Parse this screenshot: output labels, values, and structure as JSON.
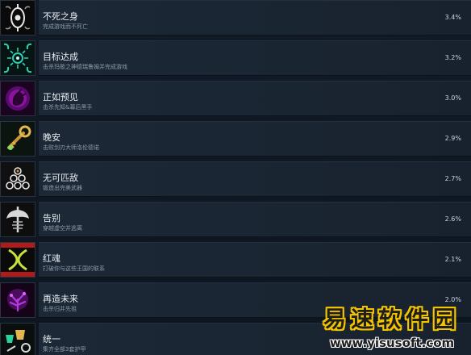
{
  "achievements": [
    {
      "title": "不死之身",
      "desc": "完成游戏而不死亡",
      "pct": "3.4%",
      "icon": "white-eye-rune-icon",
      "accent": "#e0e0e0"
    },
    {
      "title": "目标达成",
      "desc": "击杀玛歌之神德瑞鲁姆并完成游戏",
      "pct": "3.2%",
      "icon": "cyan-gear-sigil-icon",
      "accent": "#2ad1b8"
    },
    {
      "title": "正如预见",
      "desc": "击杀先知&幕后黑手",
      "pct": "3.0%",
      "icon": "magenta-hand-icon",
      "accent": "#c21fd6"
    },
    {
      "title": "晚安",
      "desc": "击败剑刃大师洛伦德诺",
      "pct": "2.9%",
      "icon": "golden-key-icon",
      "accent": "#d9a640"
    },
    {
      "title": "无可匹敌",
      "desc": "锻造出完美武器",
      "pct": "2.7%",
      "icon": "orb-pyramid-icon",
      "accent": "#e6e6e6"
    },
    {
      "title": "告别",
      "desc": "穿越虚空并逃离",
      "pct": "2.6%",
      "icon": "skeleton-axe-icon",
      "accent": "#d8d8d8"
    },
    {
      "title": "红魂",
      "desc": "打破你与这些王国的联系",
      "pct": "2.1%",
      "icon": "crossed-serpents-icon",
      "accent": "#c8e23a"
    },
    {
      "title": "再造未来",
      "desc": "击杀归井先祖",
      "pct": "2.0%",
      "icon": "purple-tree-icon",
      "accent": "#9b1fc4"
    },
    {
      "title": "统一",
      "desc": "集齐全部3套护甲",
      "pct": "",
      "icon": "armor-set-icon",
      "accent": "#2ad19a"
    }
  ],
  "watermark": {
    "cn": "易速软件园",
    "url": "www.yisusoft.com"
  }
}
